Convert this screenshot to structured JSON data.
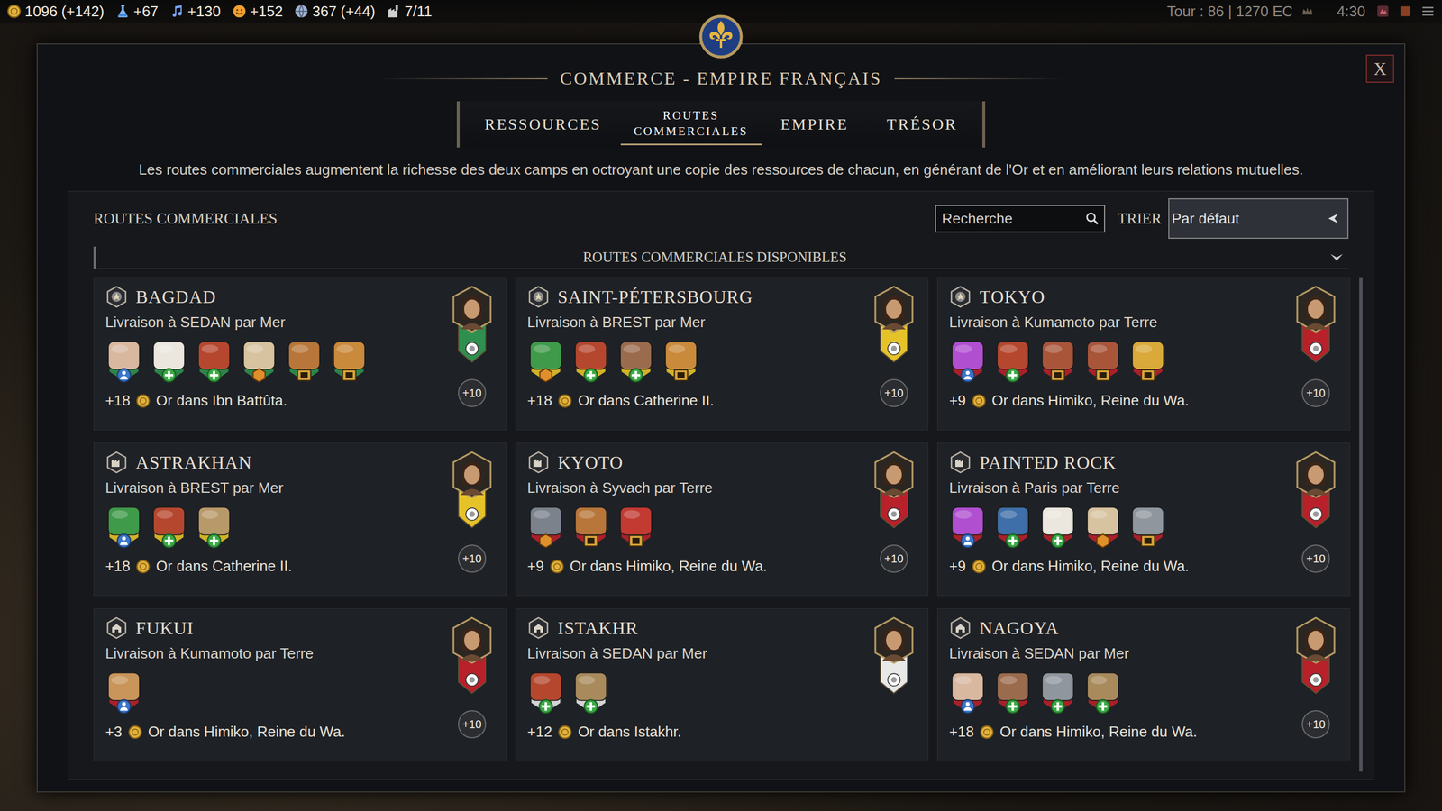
{
  "top_bar": {
    "resources": [
      {
        "kind": "gold",
        "value": "1096 (+142)"
      },
      {
        "kind": "science",
        "value": "+67"
      },
      {
        "kind": "culture",
        "value": "+130"
      },
      {
        "kind": "happiness",
        "value": "+152"
      },
      {
        "kind": "influence",
        "value": "367 (+44)"
      },
      {
        "kind": "cities",
        "value": "7/11"
      }
    ],
    "turn": "Tour : 86 | 1270 EC",
    "clock": "4:30"
  },
  "window": {
    "title": "COMMERCE - EMPIRE FRANÇAIS",
    "close": "X"
  },
  "tabs": [
    {
      "label": "RESSOURCES",
      "selected": false
    },
    {
      "label": "ROUTES COMMERCIALES",
      "selected": true
    },
    {
      "label": "EMPIRE",
      "selected": false
    },
    {
      "label": "TRÉSOR",
      "selected": false
    }
  ],
  "description": "Les routes commerciales augmentent la richesse des deux camps en octroyant une copie des ressources de chacun, en générant de l'Or et en améliorant leurs relations mutuelles.",
  "panel": {
    "title": "ROUTES COMMERCIALES",
    "search": {
      "placeholder": "Recherche"
    },
    "sort_label": "TRIER",
    "sort_value": "Par défaut",
    "group": {
      "title": "ROUTES COMMERCIALES DISPONIBLES",
      "expanded": true
    }
  },
  "routes": [
    {
      "city": "BAGDAD",
      "city_kind": "capital",
      "delivery": "Livraison à SEDAN par Mer",
      "resources": [
        {
          "kind": "person",
          "color": "#d9b8a0"
        },
        {
          "kind": "plus",
          "color": "#ebe7df"
        },
        {
          "kind": "plus",
          "color": "#b5472f"
        },
        {
          "kind": "hex",
          "color": "#d8c3a0"
        },
        {
          "kind": "chest",
          "color": "#b8763a"
        },
        {
          "kind": "chest",
          "color": "#c98a3c"
        }
      ],
      "gold": "+18",
      "gold_text": "Or dans Ibn Battûta.",
      "boost": "+10",
      "color": "#2f8f4e"
    },
    {
      "city": "SAINT-PÉTERSBOURG",
      "city_kind": "capital",
      "delivery": "Livraison à BREST par Mer",
      "resources": [
        {
          "kind": "hex",
          "color": "#3f9a4a"
        },
        {
          "kind": "plus",
          "color": "#b5472f"
        },
        {
          "kind": "plus",
          "color": "#9b6b4e"
        },
        {
          "kind": "chest",
          "color": "#c98a3c"
        }
      ],
      "gold": "+18",
      "gold_text": "Or dans Catherine II.",
      "boost": "+10",
      "color": "#e6c229"
    },
    {
      "city": "TOKYO",
      "city_kind": "capital",
      "delivery": "Livraison à Kumamoto par Terre",
      "resources": [
        {
          "kind": "person",
          "color": "#b04fd0"
        },
        {
          "kind": "plus",
          "color": "#b5472f"
        },
        {
          "kind": "chest",
          "color": "#a8553a"
        },
        {
          "kind": "chest",
          "color": "#a8553a"
        },
        {
          "kind": "chest",
          "color": "#d9a93a"
        }
      ],
      "gold": "+9",
      "gold_text": "Or dans Himiko, Reine du Wa.",
      "boost": "+10",
      "color": "#b8202a"
    },
    {
      "city": "ASTRAKHAN",
      "city_kind": "city",
      "delivery": "Livraison à BREST par Mer",
      "resources": [
        {
          "kind": "person",
          "color": "#3f9a4a"
        },
        {
          "kind": "plus",
          "color": "#b5472f"
        },
        {
          "kind": "plus",
          "color": "#b89a6a"
        }
      ],
      "gold": "+18",
      "gold_text": "Or dans Catherine II.",
      "boost": "+10",
      "color": "#e6c229"
    },
    {
      "city": "KYOTO",
      "city_kind": "city",
      "delivery": "Livraison à Syvach par Terre",
      "resources": [
        {
          "kind": "hex",
          "color": "#7b828c"
        },
        {
          "kind": "chest",
          "color": "#b8763a"
        },
        {
          "kind": "chest",
          "color": "#c23a32"
        }
      ],
      "gold": "+9",
      "gold_text": "Or dans Himiko, Reine du Wa.",
      "boost": "+10",
      "color": "#b8202a"
    },
    {
      "city": "PAINTED ROCK",
      "city_kind": "city",
      "delivery": "Livraison à Paris par Terre",
      "resources": [
        {
          "kind": "person",
          "color": "#b04fd0"
        },
        {
          "kind": "plus",
          "color": "#3f6fa8"
        },
        {
          "kind": "plus",
          "color": "#ebe7df"
        },
        {
          "kind": "hex",
          "color": "#d8c3a0"
        },
        {
          "kind": "chest",
          "color": "#8f969e"
        }
      ],
      "gold": "+9",
      "gold_text": "Or dans Himiko, Reine du Wa.",
      "boost": "+10",
      "color": "#b8202a"
    },
    {
      "city": "FUKUI",
      "city_kind": "town",
      "delivery": "Livraison à Kumamoto par Terre",
      "resources": [
        {
          "kind": "person",
          "color": "#c9955a"
        }
      ],
      "gold": "+3",
      "gold_text": "Or dans Himiko, Reine du Wa.",
      "boost": "+10",
      "color": "#b8202a"
    },
    {
      "city": "ISTAKHR",
      "city_kind": "town",
      "delivery": "Livraison à SEDAN par Mer",
      "resources": [
        {
          "kind": "plus",
          "color": "#b5472f"
        },
        {
          "kind": "plus",
          "color": "#a88a5c"
        }
      ],
      "gold": "+12",
      "gold_text": "Or dans Istakhr.",
      "boost": "",
      "color": "#e8e8e8"
    },
    {
      "city": "NAGOYA",
      "city_kind": "town",
      "delivery": "Livraison à SEDAN par Mer",
      "resources": [
        {
          "kind": "person",
          "color": "#d9b8a0"
        },
        {
          "kind": "plus",
          "color": "#9b6b4e"
        },
        {
          "kind": "plus",
          "color": "#8f969e"
        },
        {
          "kind": "plus",
          "color": "#a88a5c"
        }
      ],
      "gold": "+18",
      "gold_text": "Or dans Himiko, Reine du Wa.",
      "boost": "+10",
      "color": "#b8202a"
    }
  ]
}
